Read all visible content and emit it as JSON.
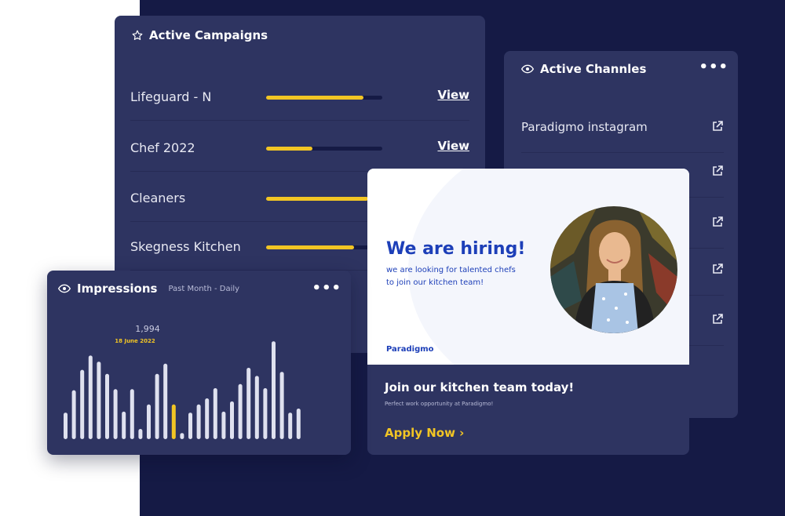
{
  "campaigns": {
    "title": "Active Campaigns",
    "rows": [
      {
        "name": "Lifeguard - N",
        "progress": 0.84,
        "action": "View"
      },
      {
        "name": "Chef 2022",
        "progress": 0.4,
        "action": "View"
      },
      {
        "name": "Cleaners",
        "progress": 0.88,
        "action": ""
      },
      {
        "name": "Skegness Kitchen",
        "progress": 0.76,
        "action": ""
      }
    ]
  },
  "channels": {
    "title": "Active Channles",
    "items": [
      {
        "name": "Paradigmo instagram"
      },
      {
        "name": ""
      },
      {
        "name": ""
      },
      {
        "name": ""
      },
      {
        "name": ""
      }
    ]
  },
  "hiring": {
    "headline": "We are hiring!",
    "subtext": "we are looking for talented chefs to join our kitchen team!",
    "brand": "Paradigmo",
    "cta_title": "Join our kitchen team today!",
    "cta_sub": "Perfect work opportunity at Paradigmo!",
    "apply_label": "Apply Now ›"
  },
  "impressions": {
    "title": "Impressions",
    "subtitle": "Past Month - Daily"
  },
  "chart_data": {
    "type": "bar",
    "title": "Impressions",
    "subtitle": "Past Month - Daily",
    "highlight_value": "1,994",
    "highlight_date": "18 June 2022",
    "highlight_index": 13,
    "ylim": [
      0,
      100
    ],
    "values": [
      26,
      48,
      68,
      82,
      76,
      64,
      49,
      27,
      49,
      10,
      34,
      64,
      74,
      34,
      6,
      26,
      34,
      40,
      50,
      27,
      37,
      54,
      70,
      62,
      50,
      96,
      66,
      26,
      30
    ],
    "colors": {
      "bar": "#dfe1ef",
      "highlight": "#f2c524"
    }
  },
  "colors": {
    "navy": "#151a45",
    "card": "#2e3461",
    "accent": "#f2c524",
    "brand_blue": "#1d3fb8"
  }
}
